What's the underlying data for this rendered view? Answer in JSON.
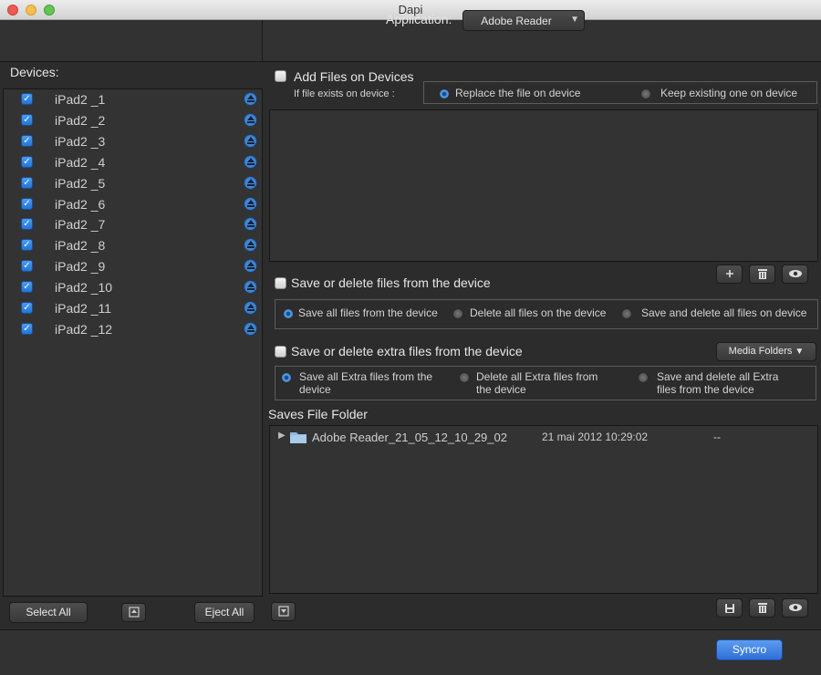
{
  "window": {
    "title": "Dapi"
  },
  "header": {
    "application_label": "Application:",
    "application_value": "Adobe Reader"
  },
  "devices": {
    "label": "Devices:",
    "items": [
      {
        "name": "iPad2 _1",
        "checked": true
      },
      {
        "name": "iPad2 _2",
        "checked": true
      },
      {
        "name": "iPad2 _3",
        "checked": true
      },
      {
        "name": "iPad2 _4",
        "checked": true
      },
      {
        "name": "iPad2 _5",
        "checked": true
      },
      {
        "name": "iPad2 _6",
        "checked": true
      },
      {
        "name": "iPad2 _7",
        "checked": true
      },
      {
        "name": "iPad2 _8",
        "checked": true
      },
      {
        "name": "iPad2 _9",
        "checked": true
      },
      {
        "name": "iPad2 _10",
        "checked": true
      },
      {
        "name": "iPad2 _11",
        "checked": true
      },
      {
        "name": "iPad2 _12",
        "checked": true
      }
    ],
    "select_all_label": "Select All",
    "eject_all_label": "Eject All"
  },
  "add_files": {
    "title": "Add Files on Devices",
    "if_exists_label": "If file exists on device :",
    "options": [
      "Replace the file on device",
      "Keep existing one on device"
    ],
    "selected": 0
  },
  "save_delete": {
    "title": "Save or delete files from the device",
    "options": [
      "Save all files from the device",
      "Delete all files on the device",
      "Save and delete all files on device"
    ],
    "selected": 0
  },
  "extra": {
    "title": "Save or delete extra files from the device",
    "media_folders_label": "Media Folders",
    "options": [
      [
        "Save all Extra files from the",
        "device"
      ],
      [
        "Delete all Extra files from",
        "the device"
      ],
      [
        "Save and delete all Extra",
        "files from the device"
      ]
    ],
    "selected": 0
  },
  "saves": {
    "title": "Saves File Folder",
    "rows": [
      {
        "name": "Adobe Reader_21_05_12_10_29_02",
        "date": "21 mai 2012 10:29:02",
        "size": "--"
      }
    ]
  },
  "footer": {
    "syncro_label": "Syncro"
  },
  "colors": {
    "accent": "#2f6fd6",
    "background": "#2c2c2c",
    "panel": "#333333"
  },
  "icons": [
    "eject-icon",
    "plus-icon",
    "trash-icon",
    "eye-icon",
    "save-icon",
    "folder-icon",
    "disclosure-triangle-icon"
  ]
}
